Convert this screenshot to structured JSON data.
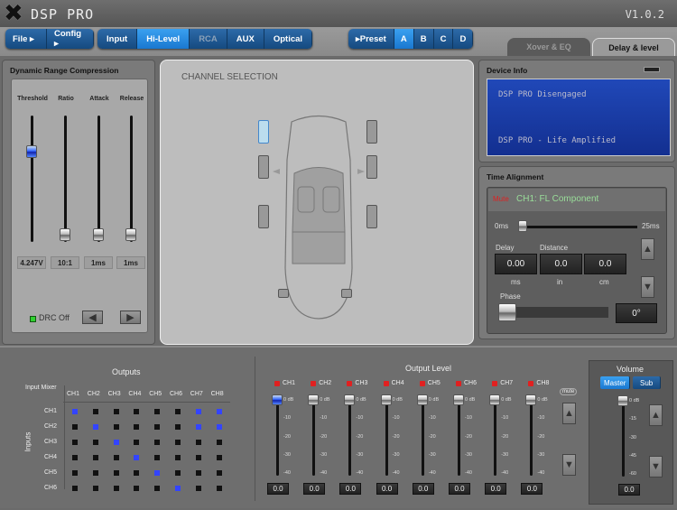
{
  "app": {
    "title": "DSP PRO",
    "version": "V1.0.2",
    "logo_text": "X"
  },
  "toolbar": {
    "file": "File ▸",
    "config": "Config ▸",
    "inputs": [
      {
        "label": "Input",
        "state": "normal"
      },
      {
        "label": "Hi-Level",
        "state": "selected"
      },
      {
        "label": "RCA",
        "state": "disabled"
      },
      {
        "label": "AUX",
        "state": "normal"
      },
      {
        "label": "Optical",
        "state": "normal"
      }
    ],
    "preset_label": "▸Preset",
    "presets": [
      {
        "label": "A",
        "selected": true
      },
      {
        "label": "B",
        "selected": false
      },
      {
        "label": "C",
        "selected": false
      },
      {
        "label": "D",
        "selected": false
      }
    ]
  },
  "tabs": [
    {
      "label": "Xover & EQ",
      "active": false
    },
    {
      "label": "Delay & level",
      "active": true
    }
  ],
  "drc": {
    "title": "Dynamic Range Compression",
    "sliders": [
      {
        "label": "Threshold",
        "value": "4.247V",
        "level": 0.7,
        "active": true
      },
      {
        "label": "Ratio",
        "value": "10:1",
        "level": 0,
        "active": false
      },
      {
        "label": "Attack",
        "value": "1ms",
        "level": 0,
        "active": false
      },
      {
        "label": "Release",
        "value": "1ms",
        "level": 0,
        "active": false
      }
    ],
    "status": "DRC Off"
  },
  "channel_selection": {
    "title": "CHANNEL SELECTION"
  },
  "device_info": {
    "title": "Device Info",
    "line1": "DSP PRO Disengaged",
    "line2": "DSP PRO - Life Amplified"
  },
  "time_alignment": {
    "title": "Time Alignment",
    "mute": "Mute",
    "channel": "CH1: FL Component",
    "min": "0ms",
    "max": "25ms",
    "delay_fraction": 0,
    "delay_label": "Distance",
    "delay_title": "Delay",
    "delay_value": "0.00",
    "delay_unit": "ms",
    "in_value": "0.0",
    "in_unit": "in",
    "cm_value": "0.0",
    "cm_unit": "cm",
    "phase_label": "Phase",
    "phase_value": "0°"
  },
  "mixer": {
    "title": "Outputs",
    "corner": "Input Mixer",
    "inputs_label": "Inputs",
    "outputs": [
      "CH1",
      "CH2",
      "CH3",
      "CH4",
      "CH5",
      "CH6",
      "CH7",
      "CH8"
    ],
    "inputs": [
      "CH1",
      "CH2",
      "CH3",
      "CH4",
      "CH5",
      "CH6"
    ],
    "routes": [
      [
        1,
        0,
        0,
        0,
        0,
        0,
        1,
        1
      ],
      [
        0,
        1,
        0,
        0,
        0,
        0,
        1,
        1
      ],
      [
        0,
        0,
        1,
        0,
        0,
        0,
        0,
        0
      ],
      [
        0,
        0,
        0,
        1,
        0,
        0,
        0,
        0
      ],
      [
        0,
        0,
        0,
        0,
        1,
        0,
        0,
        0
      ],
      [
        0,
        0,
        0,
        0,
        0,
        1,
        0,
        0
      ]
    ]
  },
  "output_level": {
    "title": "Output Level",
    "mute_label": "mute",
    "ticks": [
      "0 dB",
      "-10",
      "-20",
      "-30",
      "-40"
    ],
    "channels": [
      {
        "label": "CH1",
        "value": "0.0",
        "level": 1,
        "selected": true
      },
      {
        "label": "CH2",
        "value": "0.0",
        "level": 1
      },
      {
        "label": "CH3",
        "value": "0.0",
        "level": 1
      },
      {
        "label": "CH4",
        "value": "0.0",
        "level": 1
      },
      {
        "label": "CH5",
        "value": "0.0",
        "level": 1
      },
      {
        "label": "CH6",
        "value": "0.0",
        "level": 1
      },
      {
        "label": "CH7",
        "value": "0.0",
        "level": 1
      },
      {
        "label": "CH8",
        "value": "0.0",
        "level": 1
      }
    ]
  },
  "volume": {
    "title": "Volume",
    "master": "Master",
    "sub": "Sub",
    "ticks": [
      "0 dB",
      "-15",
      "-30",
      "-45",
      "-60"
    ],
    "value": "0.0",
    "level": 1
  },
  "colors": {
    "accent": "#1a78d0",
    "route_on": "#3344ff",
    "route_off": "#111111",
    "led_red": "#e02020",
    "led_green": "#30d030",
    "device_screen": "#1a3fa8"
  }
}
